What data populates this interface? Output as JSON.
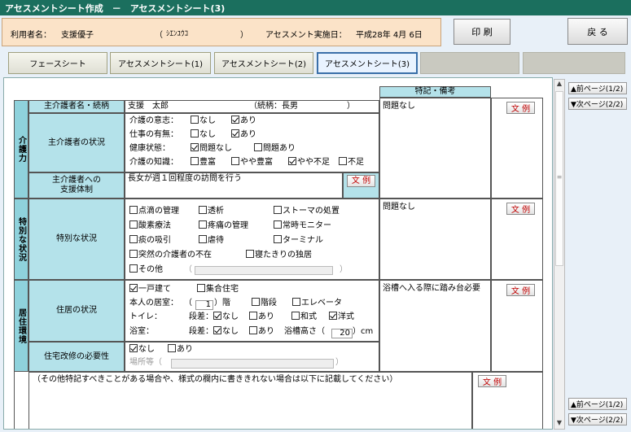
{
  "window": {
    "title": "アセスメントシート作成　－　アセスメントシート(3)"
  },
  "user": {
    "label": "利用者名：",
    "name": "支援優子",
    "kana_open": "（",
    "kana": "ｼｴﾝﾕｳｺ",
    "kana_close": "）",
    "date_label": "アセスメント実施日：",
    "date": "平成28年 4月 6日"
  },
  "buttons": {
    "print": "印 刷",
    "back": "戻 る",
    "bunrei": "文 例"
  },
  "tabs": [
    "フェースシート",
    "アセスメントシート(1)",
    "アセスメントシート(2)",
    "アセスメントシート(3)"
  ],
  "header": {
    "notes": "特記・備考"
  },
  "sections": {
    "kaigo": "介護力",
    "tokubetsu": "特別な状況",
    "kyoju": "居住環境"
  },
  "kaigo": {
    "caregiver_label": "主介護者名・続柄",
    "caregiver_name": "支援　太郎",
    "relation": "（続柄：長男　　　　　　）",
    "status_label": "主介護者の状況",
    "will_label": "介護の意志：",
    "will_no": "なし",
    "will_yes": "あり",
    "job_label": "仕事の有無：",
    "job_no": "なし",
    "job_yes": "あり",
    "health_label": "健康状態：",
    "health_ok": "問題なし",
    "health_ng": "問題あり",
    "know_label": "介護の知識：",
    "know1": "豊富",
    "know2": "やや豊富",
    "know3": "やや不足",
    "know4": "不足",
    "support_label1": "主介護者への",
    "support_label2": "支援体制",
    "support_text": "長女が週１回程度の訪問を行う",
    "note": "問題なし"
  },
  "tokubetsu": {
    "label": "特別な状況",
    "items": [
      "点滴の管理",
      "透析",
      "ストーマの処置",
      "酸素療法",
      "疼痛の管理",
      "常時モニター",
      "痰の吸引",
      "虐待",
      "ターミナル",
      "突然の介護者の不在",
      "寝たきりの独居",
      "その他"
    ],
    "note": "問題なし"
  },
  "kyoju": {
    "house_label": "住居の状況",
    "house1": "一戸建て",
    "house2": "集合住宅",
    "room_label": "本人の居室：",
    "floor": "1",
    "floor_unit": "）階",
    "floor_o": "（",
    "stairs": "階段",
    "elevator": "エレベータ",
    "toilet_label": "トイレ：",
    "step_label": "段差：",
    "nashi": "なし",
    "ari": "あり",
    "washiki": "和式",
    "yoshiki": "洋式",
    "bath_label": "浴室：",
    "tub_label": "浴槽高さ（",
    "tub_height": "20",
    "tub_unit": "）cm",
    "reform_label": "住宅改修の必要性",
    "reform_no": "なし",
    "reform_yes": "あり",
    "place_label": "場所等（",
    "note": "浴槽へ入る際に踏み台必要"
  },
  "other": {
    "text": "（その他特記すべきことがある場合や、様式の欄内に書ききれない場合は以下に記載してください）"
  },
  "nav": {
    "prev": "▲前ページ(1/2)",
    "next": "▼次ページ(2/2)"
  }
}
